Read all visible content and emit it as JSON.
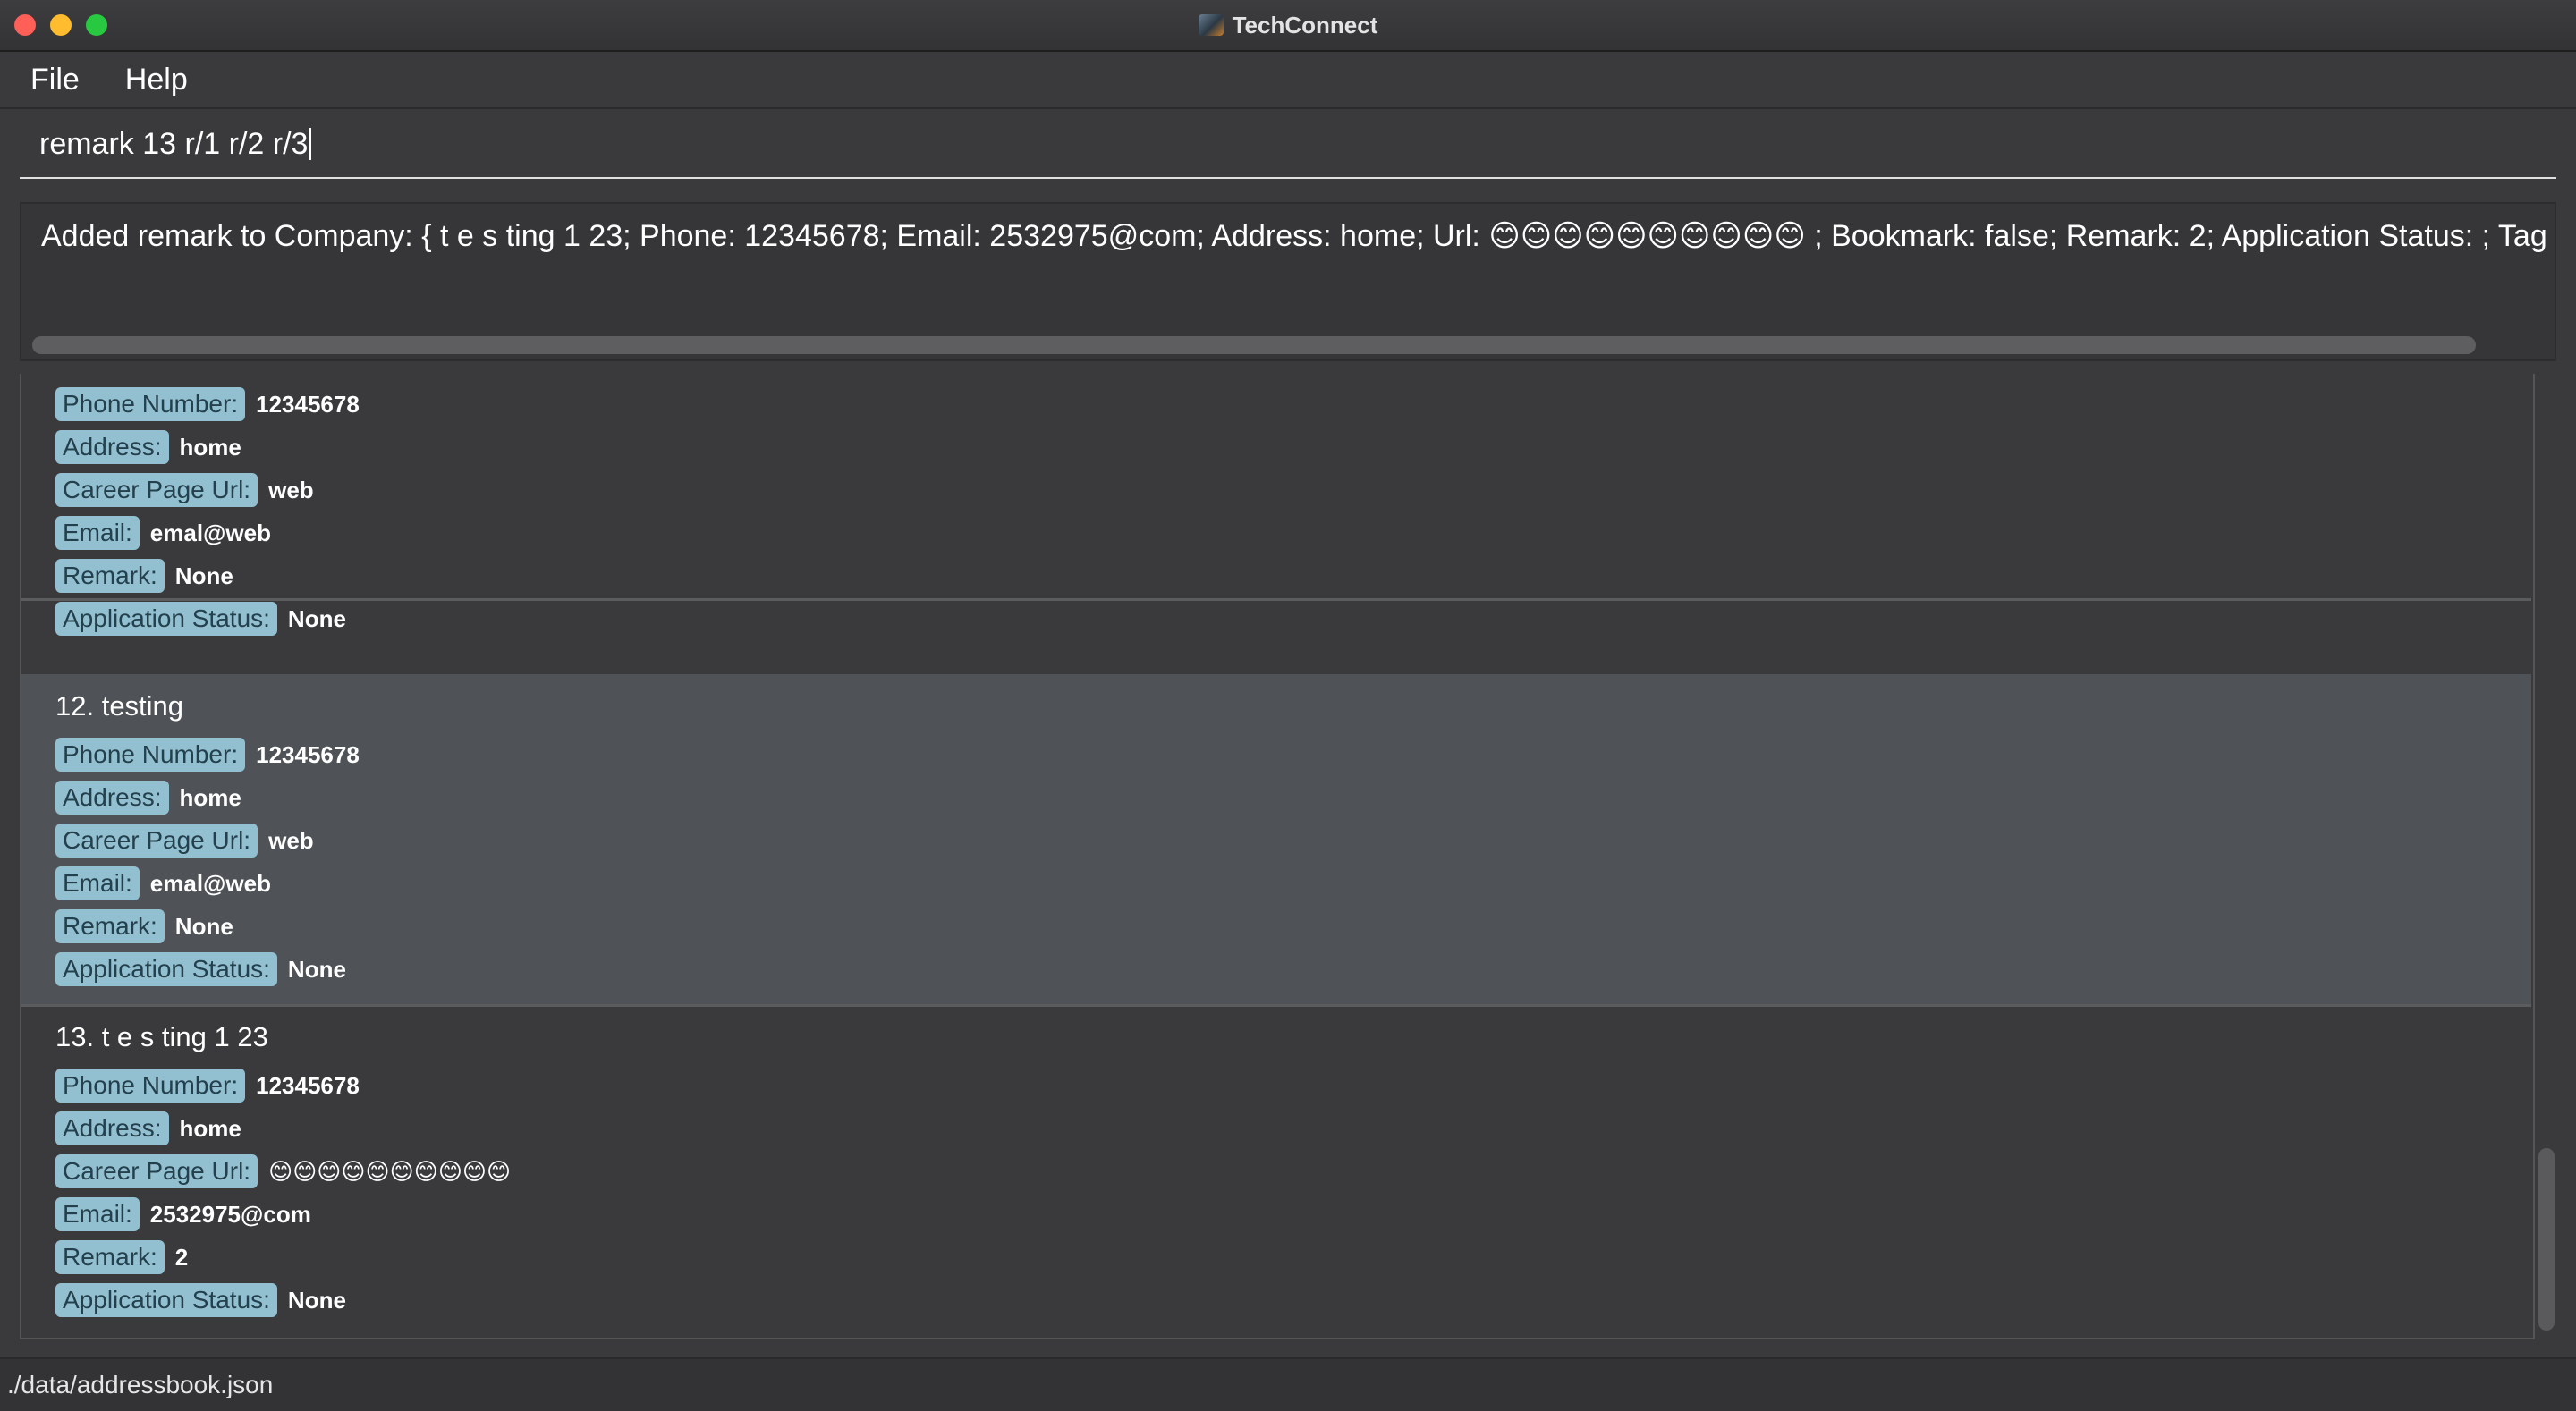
{
  "window": {
    "title": "TechConnect"
  },
  "menu": {
    "file": "File",
    "help": "Help"
  },
  "command": {
    "value": "remark 13 r/1 r/2 r/3"
  },
  "result": {
    "text": "Added remark to Company: { t    e    s    ting  1 23; Phone: 12345678; Email: 2532975@com; Address: home; Url: 😊😊😊😊😊😊😊😊😊😊 ; Bookmark: false; Remark: 2; Application Status: ; Tag"
  },
  "labels": {
    "phone": "Phone Number:",
    "address": "Address:",
    "url": "Career Page Url:",
    "email": "Email:",
    "remark": "Remark:",
    "status": "Application Status:"
  },
  "cards": [
    {
      "name": "",
      "phone": "12345678",
      "address": "home",
      "url": "web",
      "email": "emal@web",
      "remark": "None",
      "status": "None"
    },
    {
      "name": "12. testing",
      "phone": "12345678",
      "address": "home",
      "url": "web",
      "email": "emal@web",
      "remark": "None",
      "status": "None"
    },
    {
      "name": "13. t    e    s    ting  1 23",
      "phone": "12345678",
      "address": "home",
      "url": "😊😊😊😊😊😊😊😊😊😊",
      "email": "2532975@com",
      "remark": "2",
      "status": "None"
    }
  ],
  "status_bar": {
    "path": "./data/addressbook.json"
  }
}
